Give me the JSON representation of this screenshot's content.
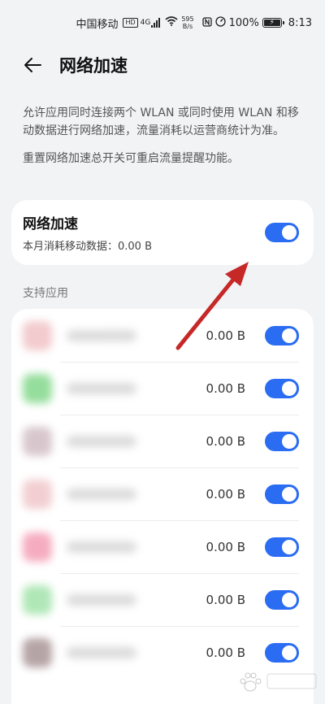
{
  "status_bar": {
    "carrier": "中国移动",
    "hd": "HD",
    "network": "4G",
    "speed_value": "595",
    "speed_unit": "B/s",
    "battery": "100%",
    "time": "8:13"
  },
  "header": {
    "title": "网络加速",
    "back_icon": "arrow-left-icon"
  },
  "description": {
    "para1": "允许应用同时连接两个 WLAN 或同时使用 WLAN 和移动数据进行网络加速，流量消耗以运营商统计为准。",
    "para2": "重置网络加速总开关可重启流量提醒功能。"
  },
  "main_toggle": {
    "label": "网络加速",
    "usage": "本月消耗移动数据：0.00 B",
    "enabled": true
  },
  "section": {
    "supported_apps": "支持应用"
  },
  "apps": [
    {
      "usage": "0.00 B",
      "enabled": true,
      "icon_color": "#e8a0a6"
    },
    {
      "usage": "0.00 B",
      "enabled": true,
      "icon_color": "#3fc24b"
    },
    {
      "usage": "0.00 B",
      "enabled": true,
      "icon_color": "#b89aa6"
    },
    {
      "usage": "0.00 B",
      "enabled": true,
      "icon_color": "#e8a7ad"
    },
    {
      "usage": "0.00 B",
      "enabled": true,
      "icon_color": "#ee6a8e"
    },
    {
      "usage": "0.00 B",
      "enabled": true,
      "icon_color": "#6fd47c"
    },
    {
      "usage": "0.00 B",
      "enabled": true,
      "icon_color": "#7a5a5e"
    }
  ],
  "colors": {
    "accent": "#2a6cf2",
    "annotation_arrow": "#c62828",
    "background": "#f1f3f5"
  }
}
